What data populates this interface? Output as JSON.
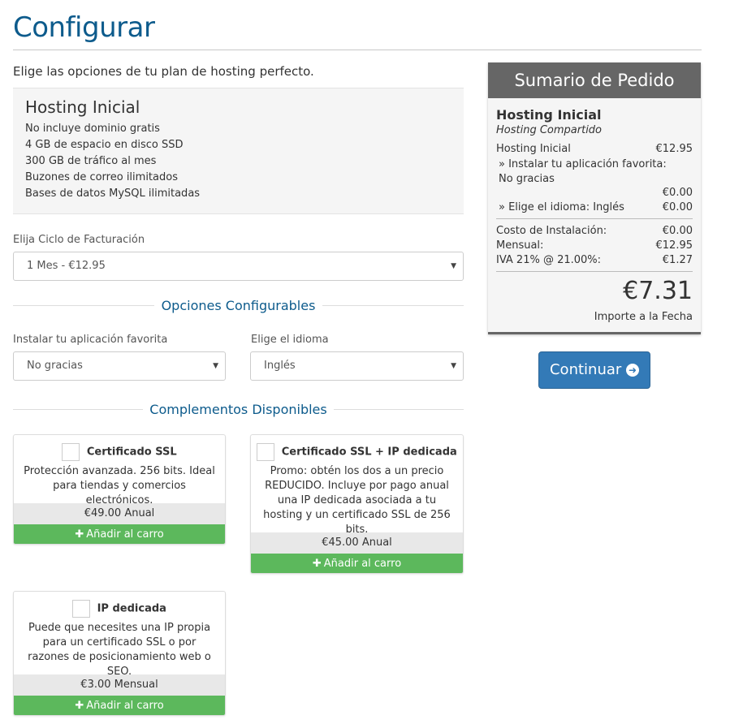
{
  "page": {
    "title": "Configurar",
    "subtitle": "Elige las opciones de tu plan de hosting perfecto."
  },
  "product": {
    "name": "Hosting Inicial",
    "features": [
      "No incluye dominio gratis",
      "4 GB de espacio en disco SSD",
      "300 GB de tráfico al mes",
      "Buzones de correo ilimitados",
      "Bases de datos MySQL ilimitadas"
    ]
  },
  "billing": {
    "label": "Elija Ciclo de Facturación",
    "selected": "1 Mes - €12.95"
  },
  "configurable": {
    "title": "Opciones Configurables",
    "app_label": "Instalar tu aplicación favorita",
    "app_selected": "No gracias",
    "lang_label": "Elige el idioma",
    "lang_selected": "Inglés"
  },
  "addons": {
    "title": "Complementos Disponibles",
    "items": [
      {
        "name": "Certificado SSL",
        "description": "Protección avanzada. 256 bits. Ideal para tiendas y comercios electrónicos.",
        "price": "€49.00 Anual",
        "button": "Añadir al carro"
      },
      {
        "name": "Certificado SSL + IP dedicada",
        "description": "Promo: obtén los dos a un precio REDUCIDO. Incluye por pago anual una IP dedicada asociada a tu hosting y un certificado SSL de 256 bits.",
        "price": "€45.00 Anual",
        "button": "Añadir al carro"
      },
      {
        "name": "IP dedicada",
        "description": "Puede que necesites una IP propia para un certificado SSL o por razones de posicionamiento web o SEO.",
        "price": "€3.00 Mensual",
        "button": "Añadir al carro"
      }
    ]
  },
  "summary": {
    "header": "Sumario de Pedido",
    "product_name": "Hosting Inicial",
    "product_group": "Hosting Compartido",
    "lines": [
      {
        "label": "Hosting Inicial",
        "value": "€12.95"
      },
      {
        "label": "» Instalar tu aplicación favorita: No gracias",
        "value": "€0.00"
      },
      {
        "label": "» Elige el idioma: Inglés",
        "value": "€0.00"
      }
    ],
    "setup_label": "Costo de Instalación:",
    "setup_value": "€0.00",
    "monthly_label": "Mensual:",
    "monthly_value": "€12.95",
    "tax_label": "IVA 21% @ 21.00%:",
    "tax_value": "€1.27",
    "total": "€7.31",
    "total_label": "Importe a la Fecha"
  },
  "actions": {
    "continue_label": "Continuar"
  },
  "colors": {
    "heading_blue": "#0d5b8c",
    "primary_button": "#337ab7",
    "success_button": "#5cb85c",
    "summary_header": "#666666"
  },
  "icons": {
    "add": "plus-icon",
    "continue": "arrow-circle-right-icon",
    "select": "caret-down-icon"
  }
}
